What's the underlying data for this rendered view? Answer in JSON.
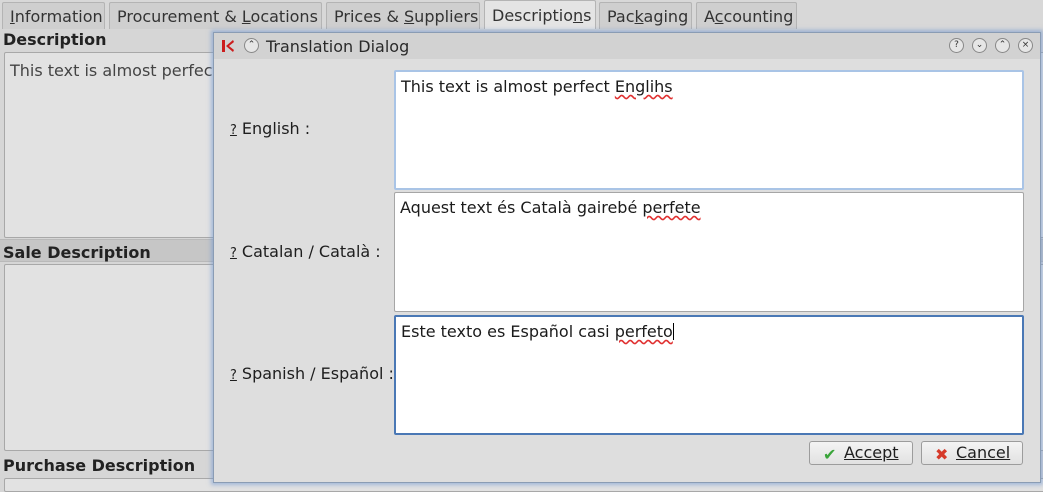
{
  "tabs": [
    {
      "pre": "",
      "ul": "I",
      "post": "nformation"
    },
    {
      "pre": "Procurement & ",
      "ul": "L",
      "post": "ocations"
    },
    {
      "pre": "Prices & ",
      "ul": "S",
      "post": "uppliers"
    },
    {
      "pre": "Descriptio",
      "ul": "n",
      "post": "s"
    },
    {
      "pre": "Pac",
      "ul": "k",
      "post": "aging"
    },
    {
      "pre": "A",
      "ul": "c",
      "post": "counting"
    }
  ],
  "form": {
    "description_label": "Description",
    "description_text": "This text is almost perfect",
    "sale_description_label": "Sale Description",
    "purchase_description_label": "Purchase Description"
  },
  "dialog": {
    "title": "Translation Dialog",
    "help_mark": "?",
    "rows": [
      {
        "label": "English :",
        "text": "This text is almost perfect ",
        "misspelled": "Englihs"
      },
      {
        "label": "Catalan / Català :",
        "text": "Aquest text és Català gairebé ",
        "misspelled": "perfete"
      },
      {
        "label": "Spanish / Español :",
        "text": "Este texto es Español casi ",
        "misspelled": "perfeto"
      }
    ],
    "accept_label": "Accept",
    "cancel_label": "Cancel",
    "accept_icon": "checkmark-icon",
    "cancel_icon": "cross-icon",
    "accent_color": "#4a78b5",
    "accept_icon_color": "#3aa53a",
    "cancel_icon_color": "#d63a2a"
  }
}
